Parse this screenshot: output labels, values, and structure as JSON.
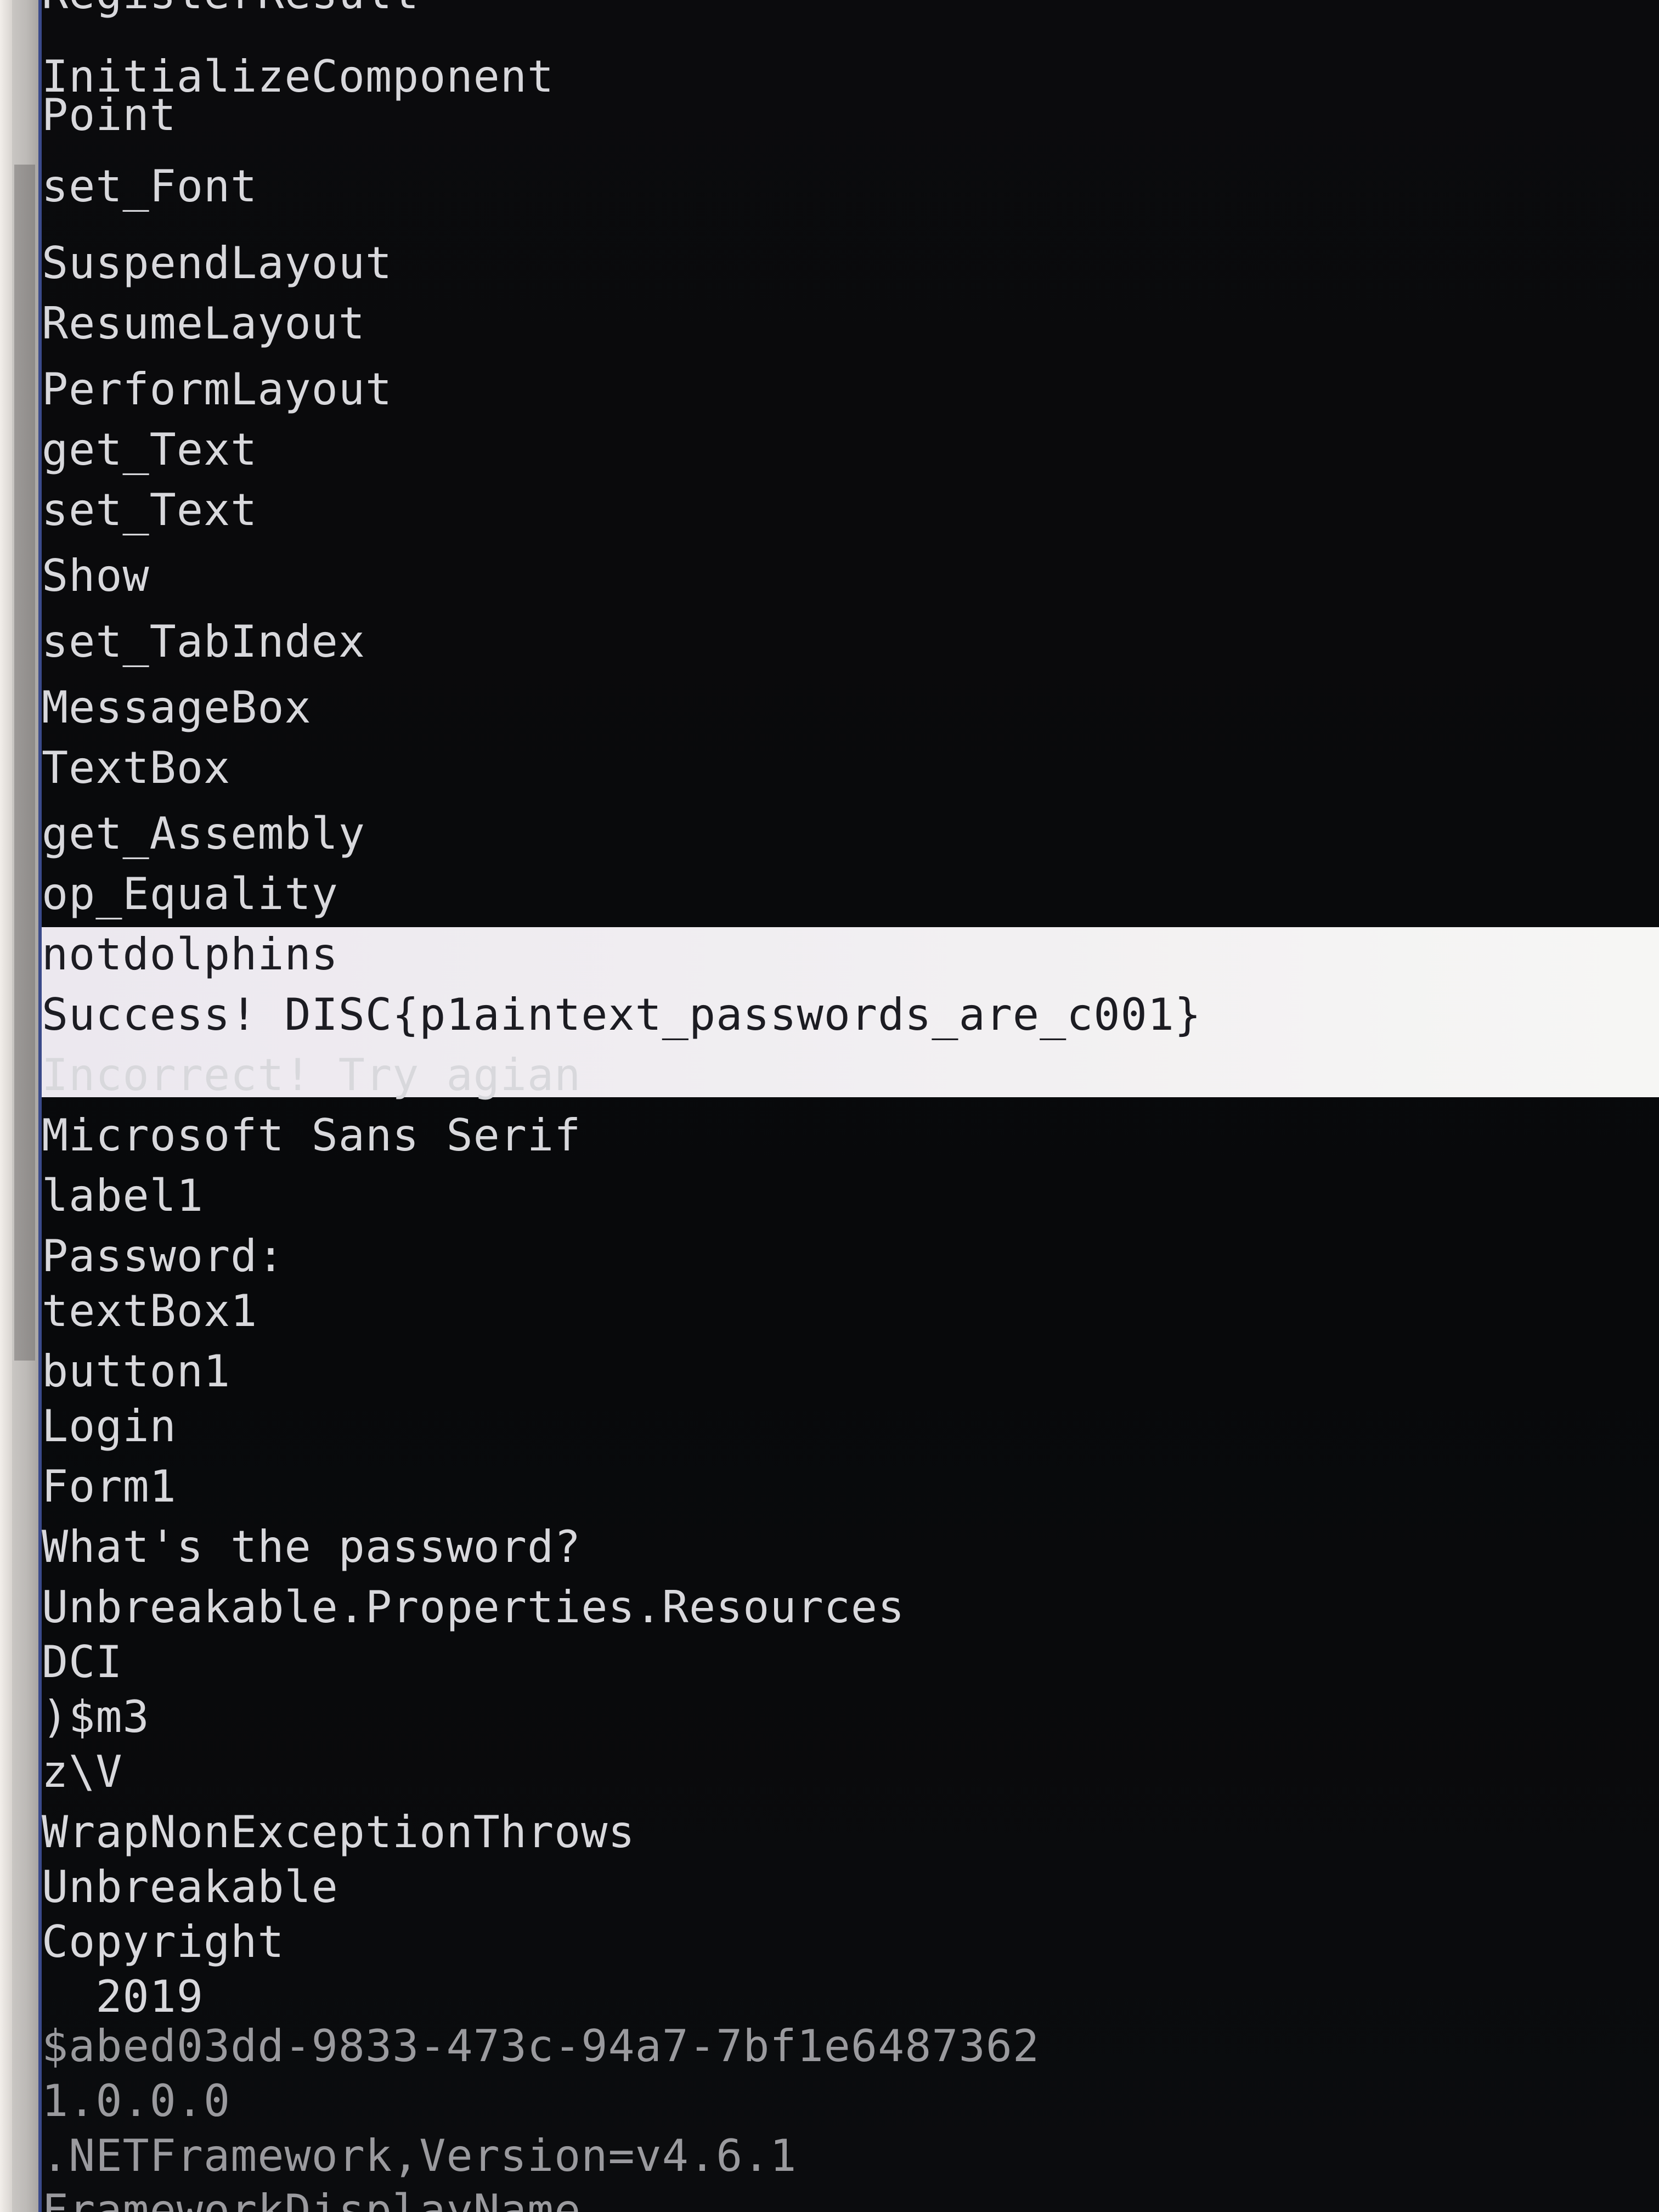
{
  "strings": [
    "RegisterResult",
    "InitializeComponent",
    "Point",
    "set_Font",
    "SuspendLayout",
    "ResumeLayout",
    "PerformLayout",
    "get_Text",
    "set_Text",
    "Show",
    "set_TabIndex",
    "MessageBox",
    "TextBox",
    "get_Assembly",
    "op_Equality",
    "notdolphins",
    "Success! DISC{p1aintext_passwords_are_c001}",
    "Incorrect! Try agian",
    "Microsoft Sans Serif",
    "label1",
    "Password:",
    "textBox1",
    "button1",
    "Login",
    "Form1",
    "What's the password?",
    "Unbreakable.Properties.Resources",
    "DCI",
    ")$m3",
    "z\\V",
    "WrapNonExceptionThrows",
    "Unbreakable",
    "Copyright",
    "  2019",
    "$abed03dd-9833-473c-94a7-7bf1e6487362",
    "1.0.0.0",
    ".NETFramework,Version=v4.6.1",
    "FrameworkDisplayName"
  ],
  "selected_strings": [
    "notdolphins",
    "Success! DISC{p1aintext_passwords_are_c001}"
  ]
}
